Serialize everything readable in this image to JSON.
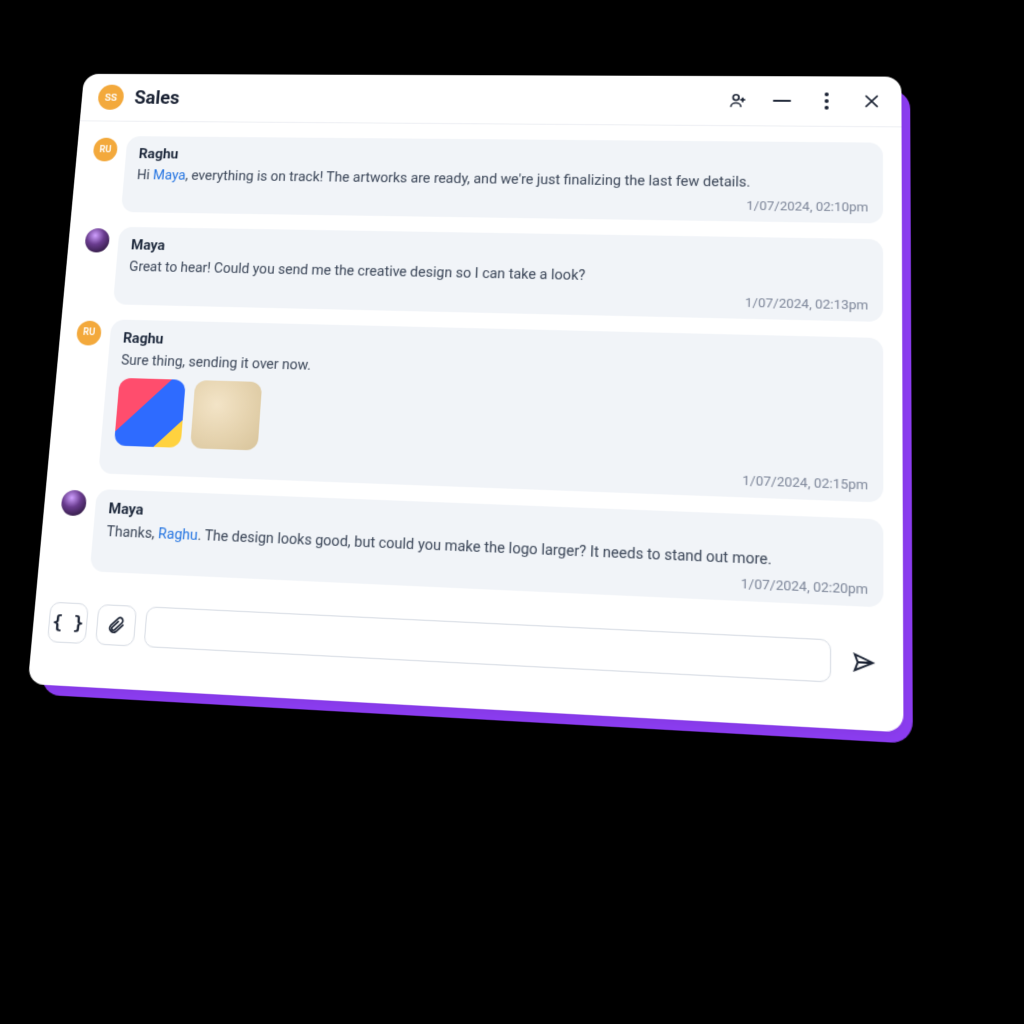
{
  "header": {
    "avatar_initials": "SS",
    "title": "Sales",
    "icons": {
      "add_user": "add-user-icon",
      "minimize": "minimize-icon",
      "more": "more-icon",
      "close": "close-icon"
    }
  },
  "messages": [
    {
      "avatar_type": "ru",
      "avatar_text": "RU",
      "sender": "Raghu",
      "body_pre": "Hi ",
      "mention": "Maya",
      "body_post": ", everything is on track! The artworks are ready, and we're just finalizing the last few details.",
      "timestamp": "1/07/2024, 02:10pm",
      "attachments": []
    },
    {
      "avatar_type": "maya",
      "avatar_text": "",
      "sender": "Maya",
      "body_pre": "Great to hear! Could you send me the creative design so I can take a look?",
      "mention": "",
      "body_post": "",
      "timestamp": "1/07/2024, 02:13pm",
      "attachments": []
    },
    {
      "avatar_type": "ru",
      "avatar_text": "RU",
      "sender": "Raghu",
      "body_pre": "Sure thing, sending it over now.",
      "mention": "",
      "body_post": "",
      "timestamp": "1/07/2024, 02:15pm",
      "attachments": [
        "t1",
        "t2"
      ]
    },
    {
      "avatar_type": "maya",
      "avatar_text": "",
      "sender": "Maya",
      "body_pre": "Thanks, ",
      "mention": "Raghu",
      "body_post": ". The design looks good, but could you make the logo larger? It needs to stand out more.",
      "timestamp": "1/07/2024, 02:20pm",
      "attachments": []
    }
  ],
  "composer": {
    "braces_label": "{ }",
    "attach_label": "attach-icon",
    "input_placeholder": "",
    "send_label": "send-icon"
  }
}
